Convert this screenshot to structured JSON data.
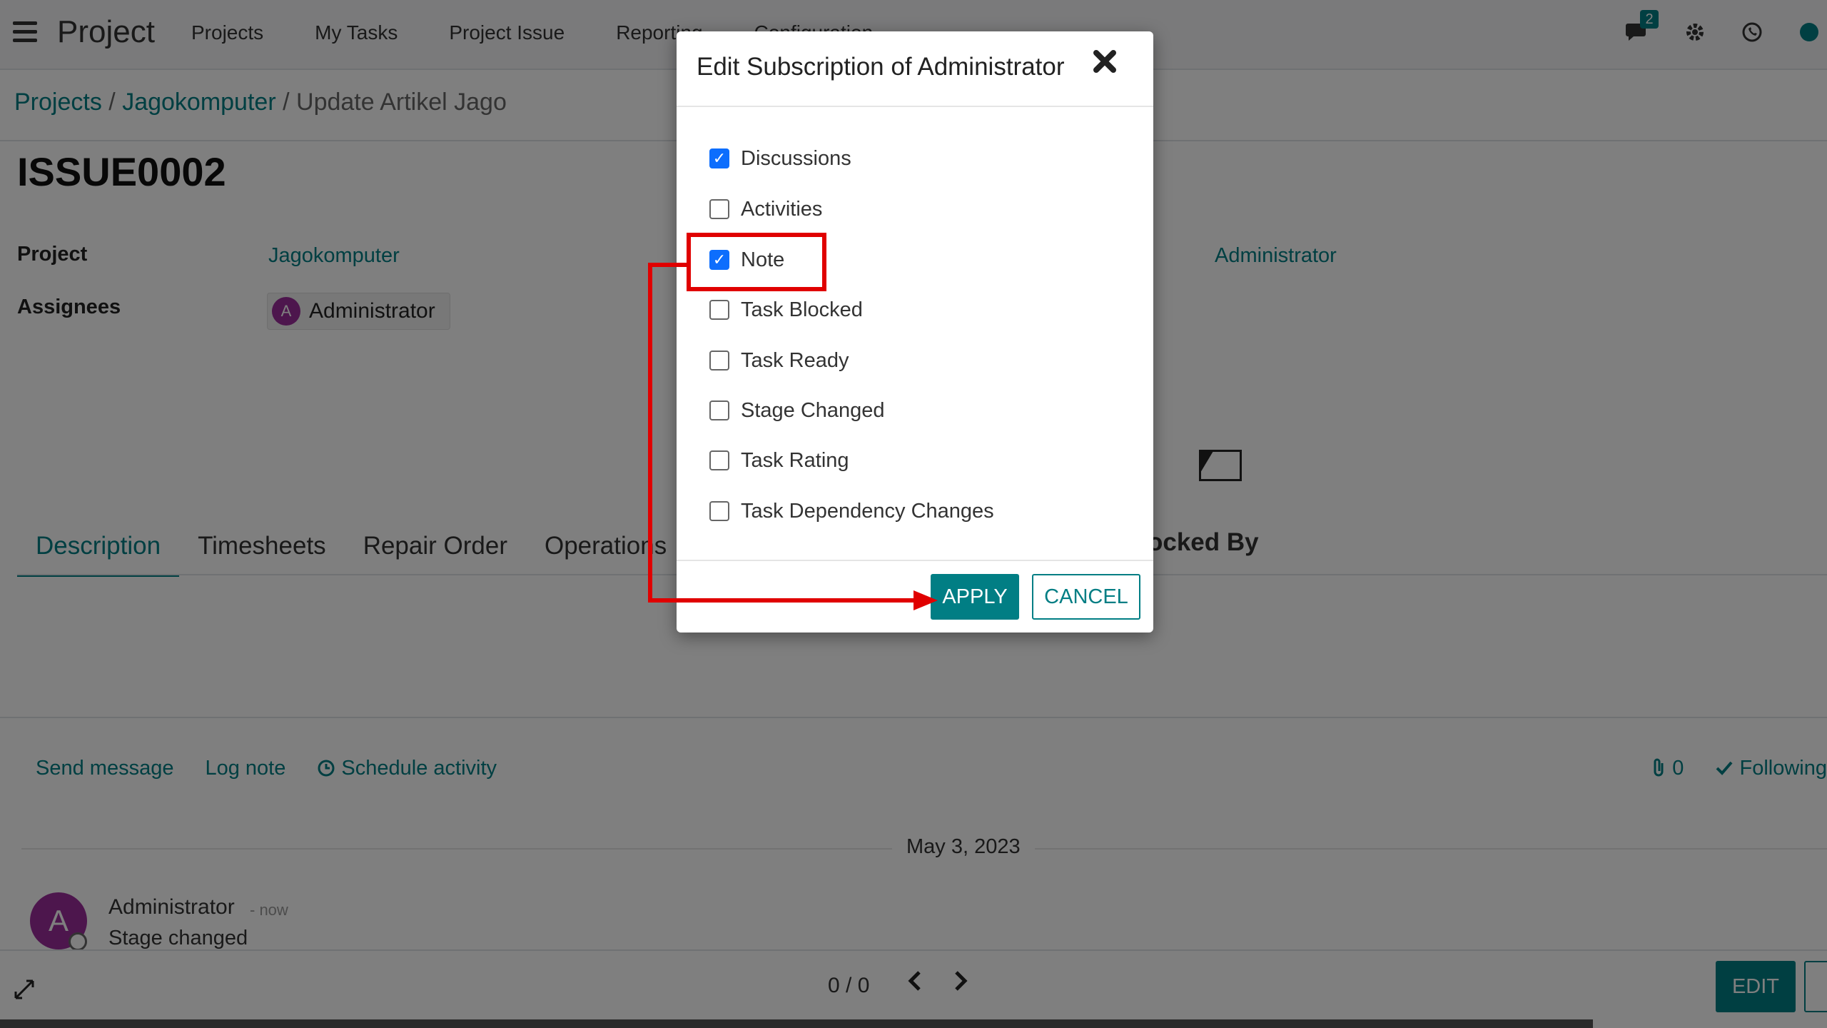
{
  "app": {
    "name": "Project"
  },
  "topnav": {
    "items": [
      "Projects",
      "My Tasks",
      "Project Issue",
      "Reporting",
      "Configuration"
    ]
  },
  "systray": {
    "chat_count": "2"
  },
  "breadcrumb": {
    "level1": "Projects",
    "level2": "Jagokomputer",
    "current": "Update Artikel Jago",
    "sep": "/"
  },
  "form": {
    "title": "ISSUE0002",
    "project_label": "Project",
    "project_value": "Jagokomputer",
    "assignees_label": "Assignees",
    "assignee_initial": "A",
    "assignee_name": "Administrator",
    "right_value": "Administrator"
  },
  "tabs": [
    "Description",
    "Timesheets",
    "Repair Order",
    "Operations"
  ],
  "tab_right_fragment": "ocked By",
  "chatter": {
    "send_message": "Send message",
    "log_note": "Log note",
    "schedule_activity": "Schedule activity",
    "attachments": "0",
    "following": "Following",
    "date": "May 3, 2023",
    "message": {
      "initial": "A",
      "author": "Administrator",
      "time": "- now",
      "body": "Stage changed"
    }
  },
  "pager": {
    "value": "0 / 0"
  },
  "bottom": {
    "edit_label": "EDIT"
  },
  "modal": {
    "title": "Edit Subscription of Administrator",
    "options": [
      {
        "label": "Discussions",
        "checked": true
      },
      {
        "label": "Activities",
        "checked": false
      },
      {
        "label": "Note",
        "checked": true
      },
      {
        "label": "Task Blocked",
        "checked": false
      },
      {
        "label": "Task Ready",
        "checked": false
      },
      {
        "label": "Stage Changed",
        "checked": false
      },
      {
        "label": "Task Rating",
        "checked": false
      },
      {
        "label": "Task Dependency Changes",
        "checked": false
      }
    ],
    "apply_label": "APPLY",
    "cancel_label": "CANCEL"
  },
  "colors": {
    "accent": "#017e84",
    "checkbox": "#0d6efd",
    "annotation": "#e00000"
  }
}
